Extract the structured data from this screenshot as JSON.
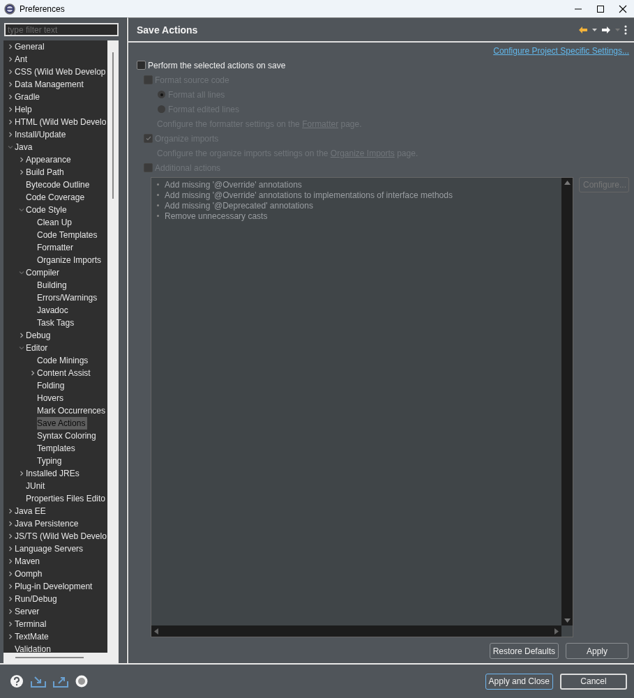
{
  "window": {
    "title": "Preferences"
  },
  "filter": {
    "placeholder": "type filter text"
  },
  "tree": [
    {
      "label": "General",
      "kind": "node",
      "expanded": false,
      "selected": false
    },
    {
      "label": "Ant",
      "kind": "node",
      "expanded": false,
      "selected": false
    },
    {
      "label": "CSS (Wild Web Develop",
      "kind": "node",
      "expanded": false,
      "selected": false
    },
    {
      "label": "Data Management",
      "kind": "node",
      "expanded": false,
      "selected": false
    },
    {
      "label": "Gradle",
      "kind": "node",
      "expanded": false,
      "selected": false
    },
    {
      "label": "Help",
      "kind": "node",
      "expanded": false,
      "selected": false
    },
    {
      "label": "HTML (Wild Web Develo",
      "kind": "node",
      "expanded": false,
      "selected": false
    },
    {
      "label": "Install/Update",
      "kind": "node",
      "expanded": false,
      "selected": false
    },
    {
      "label": "Java",
      "kind": "node",
      "expanded": true,
      "selected": false,
      "children": [
        {
          "label": "Appearance",
          "kind": "node",
          "expanded": false,
          "selected": false
        },
        {
          "label": "Build Path",
          "kind": "node",
          "expanded": false,
          "selected": false
        },
        {
          "label": "Bytecode Outline",
          "kind": "leaf",
          "selected": false
        },
        {
          "label": "Code Coverage",
          "kind": "leaf",
          "selected": false
        },
        {
          "label": "Code Style",
          "kind": "node",
          "expanded": true,
          "selected": false,
          "children": [
            {
              "label": "Clean Up",
              "kind": "leaf",
              "selected": false
            },
            {
              "label": "Code Templates",
              "kind": "leaf",
              "selected": false
            },
            {
              "label": "Formatter",
              "kind": "leaf",
              "selected": false
            },
            {
              "label": "Organize Imports",
              "kind": "leaf",
              "selected": false
            }
          ]
        },
        {
          "label": "Compiler",
          "kind": "node",
          "expanded": true,
          "selected": false,
          "children": [
            {
              "label": "Building",
              "kind": "leaf",
              "selected": false
            },
            {
              "label": "Errors/Warnings",
              "kind": "leaf",
              "selected": false
            },
            {
              "label": "Javadoc",
              "kind": "leaf",
              "selected": false
            },
            {
              "label": "Task Tags",
              "kind": "leaf",
              "selected": false
            }
          ]
        },
        {
          "label": "Debug",
          "kind": "node",
          "expanded": false,
          "selected": false
        },
        {
          "label": "Editor",
          "kind": "node",
          "expanded": true,
          "selected": false,
          "children": [
            {
              "label": "Code Minings",
              "kind": "leaf",
              "selected": false
            },
            {
              "label": "Content Assist",
              "kind": "node",
              "expanded": false,
              "selected": false
            },
            {
              "label": "Folding",
              "kind": "leaf",
              "selected": false
            },
            {
              "label": "Hovers",
              "kind": "leaf",
              "selected": false
            },
            {
              "label": "Mark Occurrences",
              "kind": "leaf",
              "selected": false
            },
            {
              "label": "Save Actions",
              "kind": "leaf",
              "selected": true
            },
            {
              "label": "Syntax Coloring",
              "kind": "leaf",
              "selected": false
            },
            {
              "label": "Templates",
              "kind": "leaf",
              "selected": false
            },
            {
              "label": "Typing",
              "kind": "leaf",
              "selected": false
            }
          ]
        },
        {
          "label": "Installed JREs",
          "kind": "node",
          "expanded": false,
          "selected": false
        },
        {
          "label": "JUnit",
          "kind": "leaf",
          "selected": false
        },
        {
          "label": "Properties Files Edito",
          "kind": "leaf",
          "selected": false
        }
      ]
    },
    {
      "label": "Java EE",
      "kind": "node",
      "expanded": false,
      "selected": false
    },
    {
      "label": "Java Persistence",
      "kind": "node",
      "expanded": false,
      "selected": false
    },
    {
      "label": "JS/TS (Wild Web Develo",
      "kind": "node",
      "expanded": false,
      "selected": false
    },
    {
      "label": "Language Servers",
      "kind": "node",
      "expanded": false,
      "selected": false
    },
    {
      "label": "Maven",
      "kind": "node",
      "expanded": false,
      "selected": false
    },
    {
      "label": "Oomph",
      "kind": "node",
      "expanded": false,
      "selected": false
    },
    {
      "label": "Plug-in Development",
      "kind": "node",
      "expanded": false,
      "selected": false
    },
    {
      "label": "Run/Debug",
      "kind": "node",
      "expanded": false,
      "selected": false
    },
    {
      "label": "Server",
      "kind": "node",
      "expanded": false,
      "selected": false
    },
    {
      "label": "Terminal",
      "kind": "node",
      "expanded": false,
      "selected": false
    },
    {
      "label": "TextMate",
      "kind": "node",
      "expanded": false,
      "selected": false
    },
    {
      "label": "Validation",
      "kind": "leaf",
      "selected": false
    }
  ],
  "page": {
    "title": "Save Actions",
    "project_link": "Configure Project Specific Settings...",
    "options": [
      {
        "kind": "checkbox",
        "label": "Perform the selected actions on save",
        "checked": false,
        "disabled": false,
        "indent": false
      },
      {
        "kind": "checkbox",
        "label": "Format source code",
        "checked": false,
        "disabled": true,
        "indent": true
      },
      {
        "kind": "radio",
        "label": "Format all lines",
        "selected": true,
        "disabled": true
      },
      {
        "kind": "radio",
        "label": "Format edited lines",
        "selected": false,
        "disabled": true
      },
      {
        "kind": "note",
        "text_before": "Configure the formatter settings on the ",
        "link": "Formatter",
        "text_after": " page.",
        "disabled": true
      },
      {
        "kind": "checkbox",
        "label": "Organize imports",
        "checked": true,
        "disabled": true,
        "indent": true
      },
      {
        "kind": "note",
        "text_before": "Configure the organize imports settings on the ",
        "link": "Organize Imports",
        "text_after": " page.",
        "disabled": true
      },
      {
        "kind": "checkbox",
        "label": "Additional actions",
        "checked": false,
        "disabled": true,
        "indent": true
      }
    ],
    "actions": [
      "Add missing '@Override' annotations",
      "Add missing '@Override' annotations to implementations of interface methods",
      "Add missing '@Deprecated' annotations",
      "Remove unnecessary casts"
    ],
    "configure_button": {
      "label": "Configure...",
      "disabled": true
    },
    "buttons": [
      "Restore Defaults",
      "Apply"
    ]
  },
  "footer_buttons": [
    {
      "label": "Apply and Close",
      "focused": true
    },
    {
      "label": "Cancel",
      "focused": false
    }
  ]
}
